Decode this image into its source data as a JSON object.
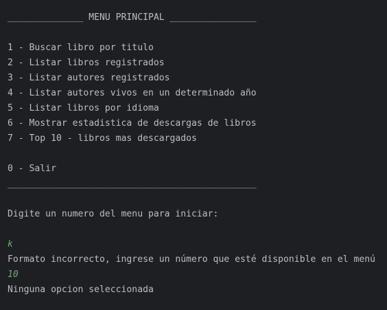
{
  "console": {
    "menu_header": "______________ MENU PRINCIPAL ________________",
    "menu_items": [
      "1 - Buscar libro por titulo",
      "2 - Listar libros registrados",
      "3 - Listar autores registrados",
      "4 - Listar autores vivos en un determinado año",
      "5 - Listar libros por idioma",
      "6 - Mostrar estadistica de descargas de libros",
      "7 - Top 10 - libros mas descargados"
    ],
    "exit_item": "0 - Salir",
    "menu_footer": "______________________________________________",
    "prompt": "Digite un numero del menu para iniciar:",
    "user_input_1": "k",
    "error_message": "Formato incorrecto, ingrese un número que esté disponible en el menú",
    "user_input_2": "10",
    "result_message": "Ninguna opcion seleccionada",
    "colors": {
      "background": "#1e1f22",
      "text": "#bcbec4",
      "user_input": "#6aab73"
    }
  }
}
